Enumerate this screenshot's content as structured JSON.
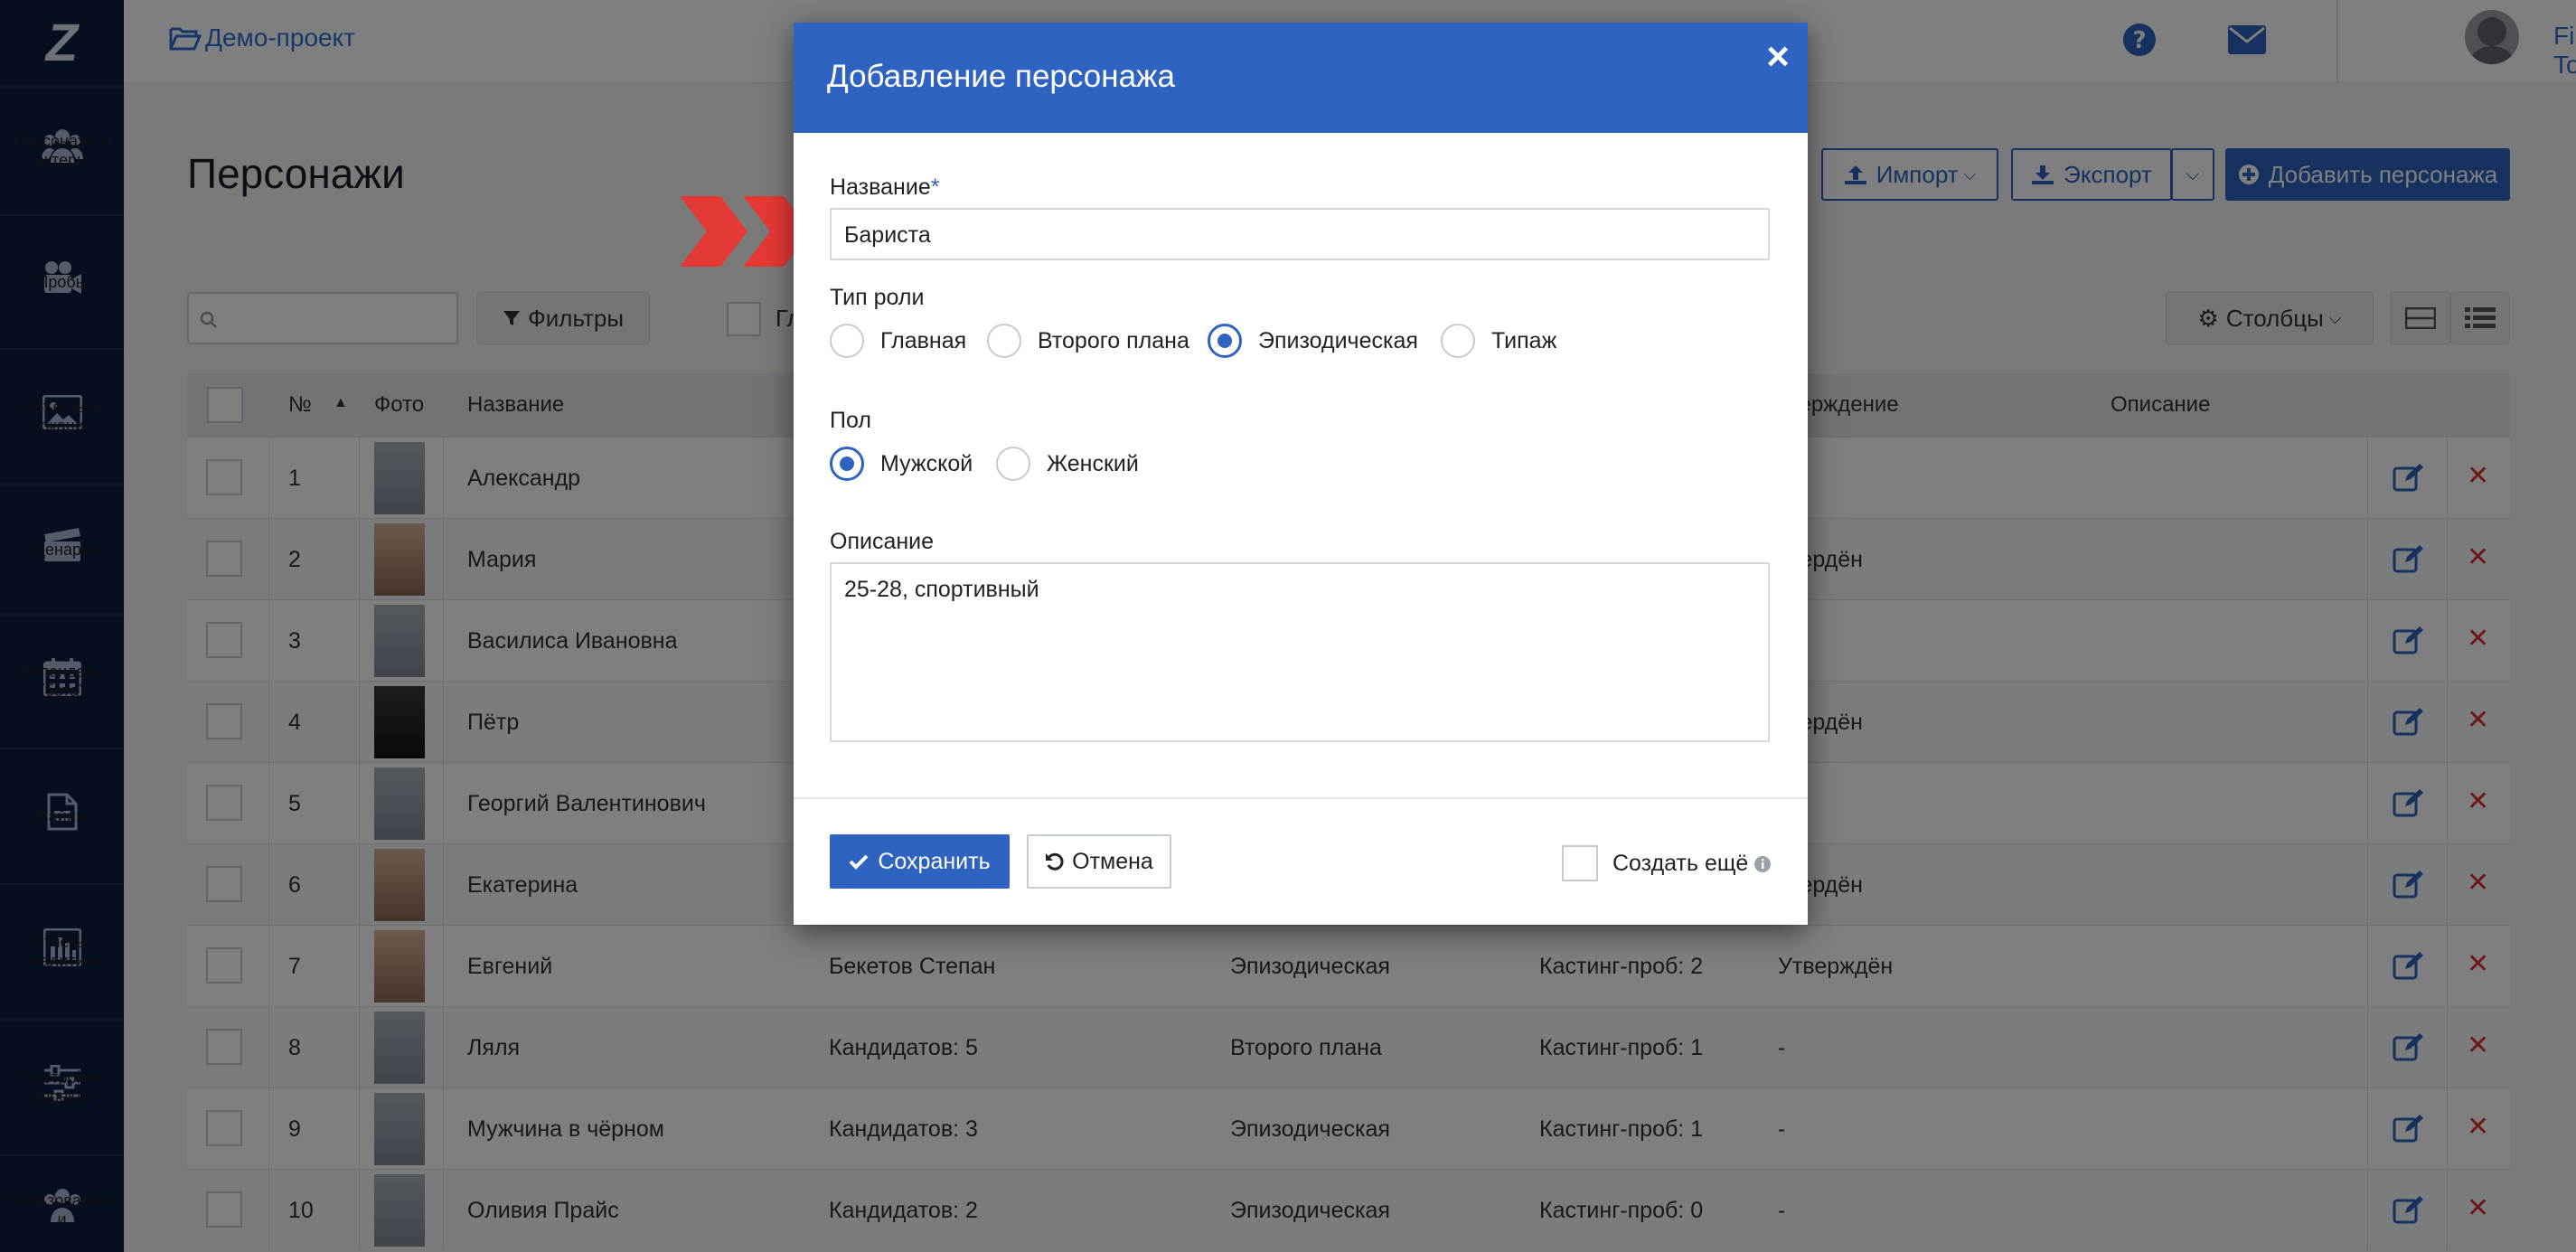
{
  "sidebar": {
    "logo": "Z",
    "items": [
      {
        "label": "Персонажи и актеры",
        "icon": "people-icon"
      },
      {
        "label": "Пробы",
        "icon": "video-camera-icon"
      },
      {
        "label": "Объекты и локации",
        "icon": "image-icon"
      },
      {
        "label": "Сценарии",
        "icon": "clapperboard-icon"
      },
      {
        "label": "Календарь (бета)",
        "icon": "calendar-icon"
      },
      {
        "label": "Файлы",
        "icon": "file-icon"
      },
      {
        "label": "Отчеты, аналитика",
        "icon": "bar-chart-icon"
      },
      {
        "label": "Настройки проекта",
        "icon": "sliders-icon"
      },
      {
        "label": "Пользователи и",
        "icon": "users-icon"
      }
    ]
  },
  "topbar": {
    "breadcrumb": "Демо-проект",
    "user_name": "Film Toolz"
  },
  "page": {
    "title": "Персонажи",
    "import_label": "Импорт",
    "export_label": "Экспорт",
    "add_label": "Добавить персонажа",
    "filters_label": "Фильтры",
    "columns_label": "Столбцы",
    "stub_label": "Гл"
  },
  "table": {
    "headers": {
      "num": "№",
      "photo": "Фото",
      "name": "Название",
      "approval": "тверждение",
      "description": "Описание"
    },
    "rows": [
      {
        "num": "1",
        "name": "Александр",
        "actor": "",
        "role": "",
        "casting": "",
        "status": "",
        "photo": "placeholder"
      },
      {
        "num": "2",
        "name": "Мария",
        "actor": "",
        "role": "",
        "casting": "",
        "status": "твердён",
        "photo": "real"
      },
      {
        "num": "3",
        "name": "Василиса Ивановна",
        "actor": "",
        "role": "",
        "casting": "",
        "status": "",
        "photo": "placeholder"
      },
      {
        "num": "4",
        "name": "Пётр",
        "actor": "",
        "role": "",
        "casting": "",
        "status": "твердён",
        "photo": "dark"
      },
      {
        "num": "5",
        "name": "Георгий Валентинович",
        "actor": "",
        "role": "",
        "casting": "",
        "status": "",
        "photo": "placeholder"
      },
      {
        "num": "6",
        "name": "Екатерина",
        "actor": "",
        "role": "",
        "casting": "",
        "status": "твердён",
        "photo": "real"
      },
      {
        "num": "7",
        "name": "Евгений",
        "actor": "Бекетов Степан",
        "role": "Эпизодическая",
        "casting": "Кастинг-проб: 2",
        "status": "Утверждён",
        "photo": "real"
      },
      {
        "num": "8",
        "name": "Ляля",
        "actor": "Кандидатов: 5",
        "role": "Второго плана",
        "casting": "Кастинг-проб: 1",
        "status": "-",
        "photo": "placeholder"
      },
      {
        "num": "9",
        "name": "Мужчина в чёрном",
        "actor": "Кандидатов: 3",
        "role": "Эпизодическая",
        "casting": "Кастинг-проб: 1",
        "status": "-",
        "photo": "placeholder"
      },
      {
        "num": "10",
        "name": "Оливия Прайс",
        "actor": "Кандидатов: 2",
        "role": "Эпизодическая",
        "casting": "Кастинг-проб: 0",
        "status": "-",
        "photo": "placeholder"
      }
    ]
  },
  "modal": {
    "title": "Добавление персонажа",
    "name_label": "Название",
    "required_mark": "*",
    "name_value": "Бариста",
    "role_label": "Тип роли",
    "role_options": [
      "Главная",
      "Второго плана",
      "Эпизодическая",
      "Типаж"
    ],
    "role_selected": "Эпизодическая",
    "gender_label": "Пол",
    "gender_options": [
      "Мужской",
      "Женский"
    ],
    "gender_selected": "Мужской",
    "description_label": "Описание",
    "description_value": "25-28, спортивный",
    "save_label": "Сохранить",
    "cancel_label": "Отмена",
    "create_more_label": "Создать ещё",
    "create_more_checked": false
  },
  "colors": {
    "primary": "#2f63c1",
    "sidebar": "#0f1c3f",
    "danger": "#d33333",
    "arrow": "#e53935"
  }
}
